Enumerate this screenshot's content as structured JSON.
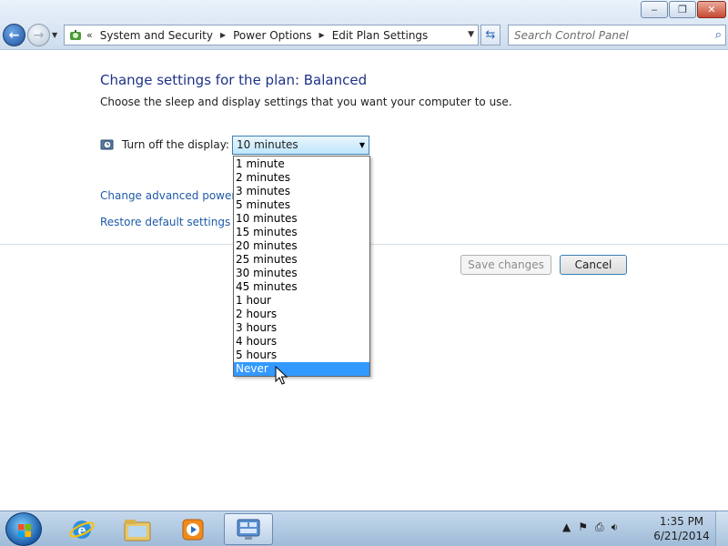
{
  "window": {
    "caption": {
      "minimize_icon": "minimize-icon",
      "maximize_icon": "restore-icon",
      "close_icon": "close-icon"
    }
  },
  "nav": {
    "back_icon": "back-arrow-icon",
    "forward_icon": "forward-arrow-icon",
    "breadcrumb_overflow": "«",
    "breadcrumbs": [
      "System and Security",
      "Power Options",
      "Edit Plan Settings"
    ],
    "search_placeholder": "Search Control Panel"
  },
  "page": {
    "heading": "Change settings for the plan: Balanced",
    "subtitle": "Choose the sleep and display settings that you want your computer to use.",
    "display_setting": {
      "label": "Turn off the display:",
      "selected": "10 minutes",
      "options": [
        "1 minute",
        "2 minutes",
        "3 minutes",
        "5 minutes",
        "10 minutes",
        "15 minutes",
        "20 minutes",
        "25 minutes",
        "30 minutes",
        "45 minutes",
        "1 hour",
        "2 hours",
        "3 hours",
        "4 hours",
        "5 hours",
        "Never"
      ],
      "highlighted": "Never"
    },
    "links": {
      "advanced": "Change advanced power se",
      "restore": "Restore default settings for t"
    },
    "buttons": {
      "save": "Save changes",
      "cancel": "Cancel"
    }
  },
  "taskbar": {
    "apps": [
      "internet-explorer-icon",
      "windows-explorer-icon",
      "media-player-icon",
      "control-panel-icon"
    ],
    "tray_icons": [
      "show-hidden-icons-icon",
      "action-center-flag-icon",
      "network-icon",
      "volume-icon"
    ],
    "time": "1:35 PM",
    "date": "6/21/2014"
  }
}
